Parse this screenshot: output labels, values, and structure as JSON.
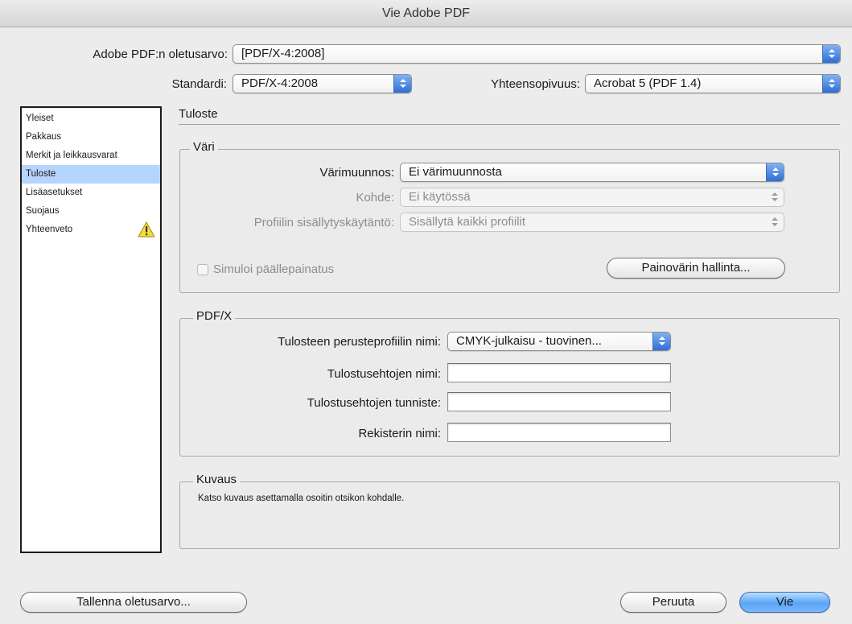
{
  "window": {
    "title": "Vie Adobe PDF"
  },
  "top": {
    "preset_label": "Adobe PDF:n oletusarvo:",
    "preset_value": "[PDF/X-4:2008]",
    "standard_label": "Standardi:",
    "standard_value": "PDF/X-4:2008",
    "compat_label": "Yhteensopivuus:",
    "compat_value": "Acrobat 5 (PDF 1.4)"
  },
  "sidebar": {
    "items": [
      {
        "label": "Yleiset"
      },
      {
        "label": "Pakkaus"
      },
      {
        "label": "Merkit ja leikkausvarat"
      },
      {
        "label": "Tuloste"
      },
      {
        "label": "Lisäasetukset"
      },
      {
        "label": "Suojaus"
      },
      {
        "label": "Yhteenveto"
      }
    ],
    "selected": "Tuloste",
    "warning_icon": "warning-triangle-icon"
  },
  "panel": {
    "title": "Tuloste",
    "color": {
      "title": "Väri",
      "conversion_label": "Värimuunnos:",
      "conversion_value": "Ei värimuunnosta",
      "destination_label": "Kohde:",
      "destination_value": "Ei käytössä",
      "profile_policy_label": "Profiilin sisällytyskäytäntö:",
      "profile_policy_value": "Sisällytä kaikki profiilit",
      "simulate_overprint_label": "Simuloi päällepainatus",
      "ink_manager_label": "Painovärin hallinta..."
    },
    "pdfx": {
      "title": "PDF/X",
      "output_intent_label": "Tulosteen perusteprofiilin nimi:",
      "output_intent_value": "CMYK-julkaisu - tuovinen...",
      "condition_name_label": "Tulostusehtojen nimi:",
      "condition_name_value": "",
      "condition_id_label": "Tulostusehtojen tunniste:",
      "condition_id_value": "",
      "registry_label": "Rekisterin nimi:",
      "registry_value": ""
    },
    "description": {
      "title": "Kuvaus",
      "text": "Katso kuvaus asettamalla osoitin otsikon kohdalle."
    }
  },
  "buttons": {
    "save_preset": "Tallenna oletusarvo...",
    "cancel": "Peruuta",
    "export": "Vie"
  },
  "colors": {
    "selection": "#b5d5ff",
    "accent_blue": "#2f6dd8",
    "window_bg": "#ececec"
  }
}
